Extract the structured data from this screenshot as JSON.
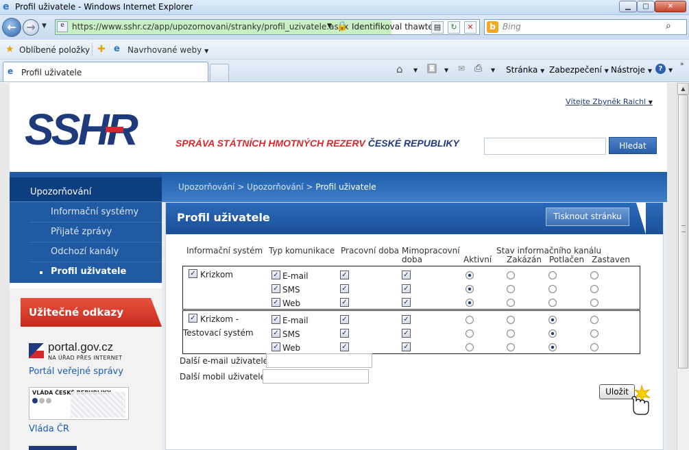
{
  "browser": {
    "window_title": "Profil uživatele - Windows Internet Explorer",
    "url": "https://www.sshr.cz/app/upozornovani/stranky/profil_uzivatele.aspx",
    "identity": "Identifikoval thawte",
    "search_placeholder": "Bing",
    "favorites_label": "Oblíbené položky",
    "suggested_sites": "Navrhované weby",
    "tab_title": "Profil uživatele",
    "menu_page": "Stránka",
    "menu_safety": "Zabezpečení",
    "menu_tools": "Nástroje"
  },
  "header": {
    "welcome": "Vítejte Zbyněk Raichl",
    "logo_text": "SSHR",
    "tagline_red": "SPRÁVA STÁTNÍCH HMOTNÝCH REZERV",
    "tagline_blue": "ČESKÉ REPUBLIKY",
    "search_button": "Hledat"
  },
  "nav": {
    "header": "Upozorňování",
    "items": [
      {
        "label": "Informační systémy"
      },
      {
        "label": "Přijaté zprávy"
      },
      {
        "label": "Odchozí kanály"
      },
      {
        "label": "Profil uživatele"
      }
    ]
  },
  "useful_links": {
    "title": "Užitečné odkazy",
    "portal_logo": "portal.gov.cz",
    "portal_sub": "NA ÚŘAD PŘES INTERNET",
    "portal_link": "Portál veřejné správy",
    "vlada_logo": "VLÁDA ČESKÉ REPUBLIKY",
    "vlada_link": "Vláda ČR"
  },
  "breadcrumb": {
    "part1": "Upozorňování",
    "sep": ">",
    "part2": "Upozorňování",
    "current": "Profil uživatele"
  },
  "content": {
    "title": "Profil uživatele",
    "print_button": "Tisknout stránku",
    "columns": {
      "system": "Informační systém",
      "comm": "Typ komunikace",
      "work": "Pracovní doba",
      "offwork_1": "Mimopracovní",
      "offwork_2": "doba",
      "state": "Stav informačního kanálu",
      "active": "Aktivní",
      "forbidden": "Zakázán",
      "suppressed": "Potlačen",
      "stopped": "Zastaven"
    },
    "systems": [
      {
        "name_1": "Krizkom",
        "name_2": "",
        "checked": true,
        "channels": [
          {
            "type": "E-mail",
            "enabled": true,
            "work": true,
            "offwork": true,
            "state": "active"
          },
          {
            "type": "SMS",
            "enabled": true,
            "work": true,
            "offwork": true,
            "state": "active"
          },
          {
            "type": "Web",
            "enabled": true,
            "work": true,
            "offwork": true,
            "state": "active"
          }
        ]
      },
      {
        "name_1": "Krizkom -",
        "name_2": "Testovací systém",
        "checked": true,
        "channels": [
          {
            "type": "E-mail",
            "enabled": true,
            "work": true,
            "offwork": true,
            "state": "suppressed"
          },
          {
            "type": "SMS",
            "enabled": true,
            "work": true,
            "offwork": true,
            "state": "suppressed"
          },
          {
            "type": "Web",
            "enabled": true,
            "work": true,
            "offwork": true,
            "state": "suppressed"
          }
        ]
      }
    ],
    "email_label": "Další e-mail uživatele",
    "email_value": "",
    "mobile_label": "Další mobil uživatele",
    "mobile_value": "",
    "save_button": "Uložit"
  },
  "colors": {
    "brand_blue": "#1e3a7a",
    "brand_red": "#d4282e",
    "nav_blue": "#1f5aa3"
  }
}
